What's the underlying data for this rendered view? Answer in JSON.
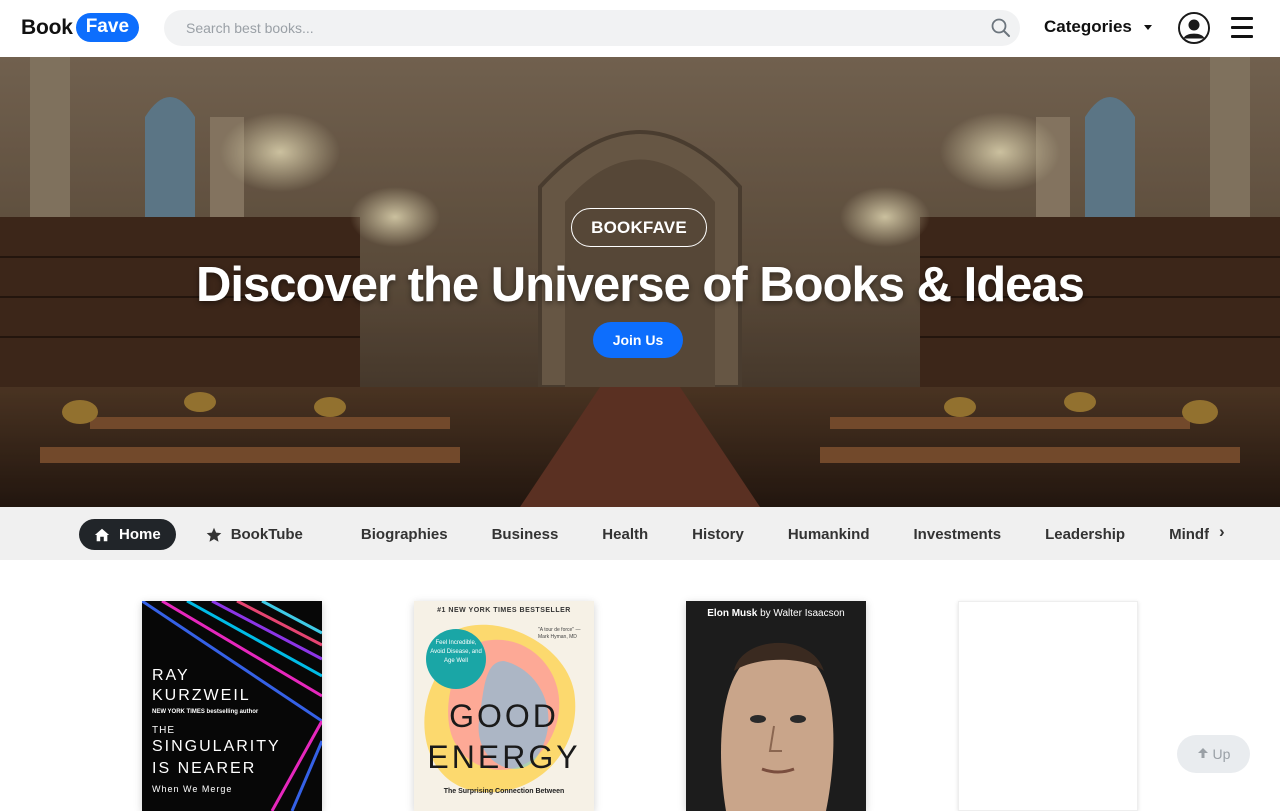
{
  "header": {
    "logo_part1": "Book",
    "logo_part2": "Fave",
    "search_placeholder": "Search best books...",
    "categories_label": "Categories",
    "brand_color": "#0d6efd"
  },
  "hero": {
    "badge": "BOOKFAVE",
    "title": "Discover the Universe of Books & Ideas",
    "cta_label": "Join Us"
  },
  "category_nav": {
    "items": [
      {
        "label": "Home",
        "icon": "home-icon",
        "active": true
      },
      {
        "label": "BookTube",
        "icon": "star-icon",
        "active": false
      },
      {
        "label": "Biographies"
      },
      {
        "label": "Business"
      },
      {
        "label": "Health"
      },
      {
        "label": "History"
      },
      {
        "label": "Humankind"
      },
      {
        "label": "Investments"
      },
      {
        "label": "Leadership"
      },
      {
        "label": "Mindful"
      }
    ],
    "next_label": "›"
  },
  "books": [
    {
      "line1": "RAY",
      "line2": "KURZWEIL",
      "tagline": "NEW YORK TIMES bestselling author",
      "title_a": "THE",
      "title_b": "SINGULARITY",
      "title_c": "IS NEARER",
      "subtitle": "When We Merge"
    },
    {
      "banner": "#1 NEW YORK TIMES BESTSELLER",
      "circle_text": "Feel Incredible, Avoid Disease, and Age Well",
      "quote": "\"A tour de force\" — Mark Hyman, MD",
      "title_a": "GOOD",
      "title_b": "ENERGY",
      "subtitle": "The Surprising Connection Between"
    },
    {
      "author_line": "Elon Musk",
      "by_line": "by Walter Isaacson"
    },
    {}
  ],
  "scroll_up": {
    "label": "Up"
  }
}
